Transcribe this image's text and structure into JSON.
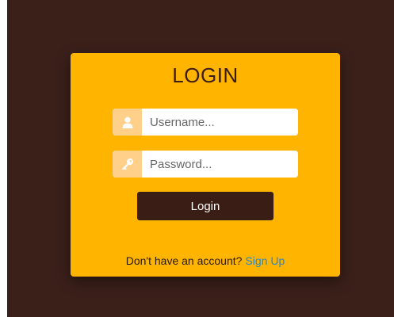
{
  "login_card": {
    "title": "LOGIN",
    "username": {
      "icon": "user-icon",
      "placeholder": "Username...",
      "value": ""
    },
    "password": {
      "icon": "key-icon",
      "placeholder": "Password...",
      "value": ""
    },
    "login_button_label": "Login",
    "signup_prompt": "Don't have an account?",
    "signup_link_label": "Sign Up"
  },
  "colors": {
    "background": "#3b201a",
    "card": "#ffb400",
    "icon_addon": "#ffd08a",
    "button": "#3a1d14",
    "link": "#1e88d6"
  }
}
